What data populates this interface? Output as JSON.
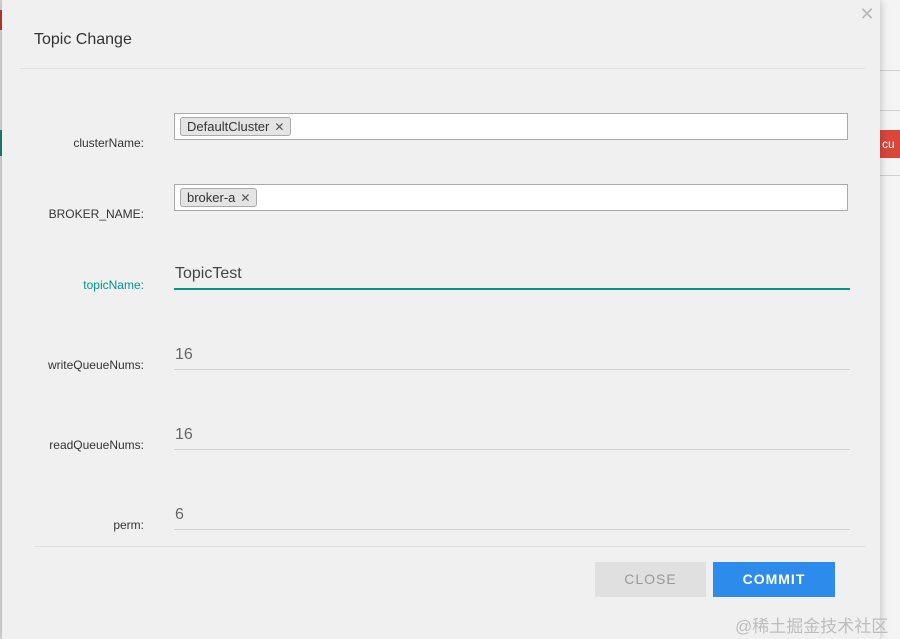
{
  "background": {
    "right_button_text": "cu"
  },
  "dialog": {
    "title": "Topic Change",
    "close_icon": "close-icon",
    "fields": {
      "clusterName": {
        "label": "clusterName:",
        "chips": [
          "DefaultCluster"
        ]
      },
      "brokerName": {
        "label": "BROKER_NAME:",
        "chips": [
          "broker-a"
        ]
      },
      "topicName": {
        "label": "topicName:",
        "value": "TopicTest"
      },
      "writeQueueNums": {
        "label": "writeQueueNums:",
        "value": "16"
      },
      "readQueueNums": {
        "label": "readQueueNums:",
        "value": "16"
      },
      "perm": {
        "label": "perm:",
        "value": "6"
      }
    },
    "buttons": {
      "close_label": "CLOSE",
      "commit_label": "COMMIT"
    }
  },
  "colors": {
    "accent": "#009688",
    "commit": "#2d8ceb",
    "background_red": "#d9463c"
  },
  "watermark": "@稀土掘金技术社区"
}
